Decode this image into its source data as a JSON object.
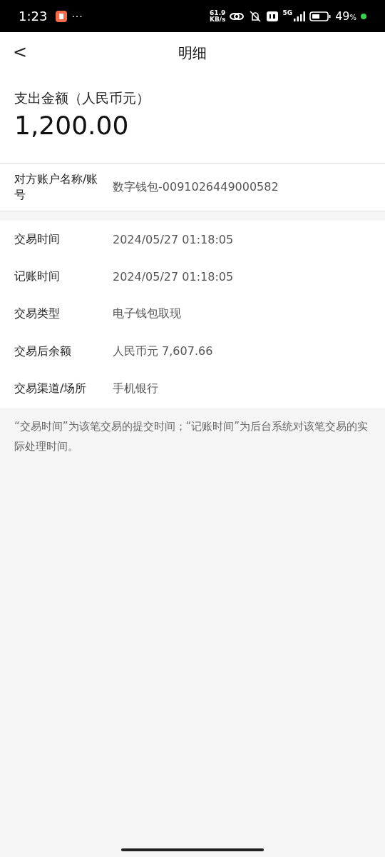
{
  "status_bar": {
    "time": "1:23",
    "more": "···",
    "speed_value": "61.9",
    "speed_unit": "KB/s",
    "network": "5G",
    "battery": "49",
    "battery_unit": "%"
  },
  "header": {
    "back": "<",
    "title": "明细"
  },
  "amount": {
    "label": "支出金额（人民币元）",
    "value": "1,200.00"
  },
  "counterparty": {
    "label": "对方账户名称/账号",
    "value": "数字钱包-0091026449000582"
  },
  "details": [
    {
      "label": "交易时间",
      "value": "2024/05/27  01:18:05"
    },
    {
      "label": "记账时间",
      "value": "2024/05/27  01:18:05"
    },
    {
      "label": "交易类型",
      "value": "电子钱包取现"
    },
    {
      "label": "交易后余额",
      "value": "人民币元 7,607.66"
    },
    {
      "label": "交易渠道/场所",
      "value": "手机银行"
    }
  ],
  "note": "“交易时间”为该笔交易的提交时间；“记账时间”为后台系统对该笔交易的实际处理时间。"
}
